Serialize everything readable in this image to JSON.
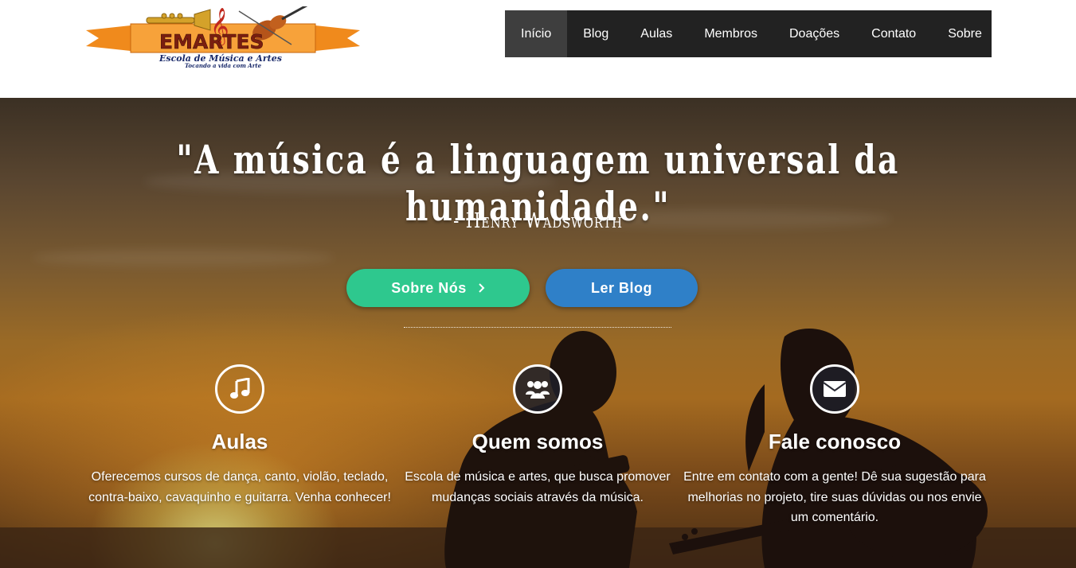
{
  "header": {
    "logo": {
      "name": "EMARTES",
      "subtitle": "Escola de Música e Artes",
      "tagline": "Tocando a vida com Arte"
    },
    "nav": [
      {
        "label": "Início",
        "active": true
      },
      {
        "label": "Blog",
        "active": false
      },
      {
        "label": "Aulas",
        "active": false
      },
      {
        "label": "Membros",
        "active": false
      },
      {
        "label": "Doações",
        "active": false
      },
      {
        "label": "Contato",
        "active": false
      },
      {
        "label": "Sobre",
        "active": false
      }
    ]
  },
  "hero": {
    "quote": "\"A música é a linguagem universal da humanidade.\"",
    "author": "- Henry Wadsworth",
    "buttons": {
      "primary_label": "Sobre Nós",
      "primary_icon": "chevron-right-icon",
      "secondary_label": "Ler Blog"
    },
    "colors": {
      "primary_button": "#2ec88e",
      "secondary_button": "#2f80c8",
      "nav_background": "#222222",
      "nav_active": "#3e3e3e"
    }
  },
  "features": [
    {
      "icon": "music-note-icon",
      "title": "Aulas",
      "text": "Oferecemos cursos de dança, canto, violão, teclado, contra-baixo, cavaquinho e guitarra. Venha conhecer!"
    },
    {
      "icon": "users-icon",
      "title": "Quem somos",
      "text": "Escola de música e artes, que busca promover mudanças sociais através da música."
    },
    {
      "icon": "envelope-icon",
      "title": "Fale conosco",
      "text": "Entre em contato com a gente! Dê sua sugestão para melhorias no projeto, tire suas dúvidas ou nos envie um comentário."
    }
  ]
}
